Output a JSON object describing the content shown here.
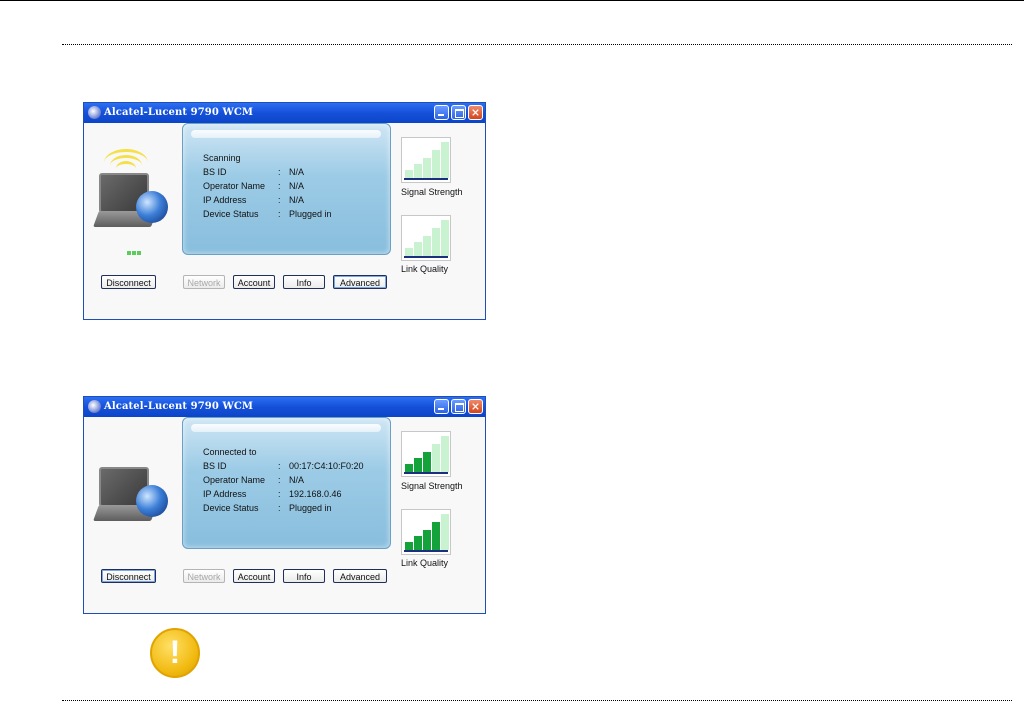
{
  "windows": [
    {
      "title": "Alcatel-Lucent 9790 WCM",
      "status": "Scanning",
      "rows": [
        {
          "label": "BS ID",
          "value": "N/A"
        },
        {
          "label": "Operator Name",
          "value": "N/A"
        },
        {
          "label": "IP Address",
          "value": "N/A"
        },
        {
          "label": "Device Status",
          "value": "Plugged in"
        }
      ],
      "buttons": {
        "disconnect": "Disconnect",
        "network": "Network",
        "account": "Account",
        "info": "Info",
        "advanced": "Advanced"
      },
      "meters": {
        "signal_label": "Signal Strength",
        "link_label": "Link Quality",
        "signal_level": 0,
        "link_level": 0
      }
    },
    {
      "title": "Alcatel-Lucent 9790 WCM",
      "status": "Connected to",
      "rows": [
        {
          "label": "BS ID",
          "value": "00:17:C4:10:F0:20"
        },
        {
          "label": "Operator Name",
          "value": "N/A"
        },
        {
          "label": "IP Address",
          "value": "192.168.0.46"
        },
        {
          "label": "Device Status",
          "value": "Plugged in"
        }
      ],
      "buttons": {
        "disconnect": "Disconnect",
        "network": "Network",
        "account": "Account",
        "info": "Info",
        "advanced": "Advanced"
      },
      "meters": {
        "signal_label": "Signal Strength",
        "link_label": "Link Quality",
        "signal_level": 3,
        "link_level": 4
      }
    }
  ],
  "colors": {
    "bar_active": "#14a33a",
    "bar_inactive": "#c9f2d0",
    "titlebar": "#1a57e0"
  },
  "icons": {
    "app": "app-globe-icon",
    "warning": "warning-exclamation-icon"
  },
  "warning_glyph": "!"
}
